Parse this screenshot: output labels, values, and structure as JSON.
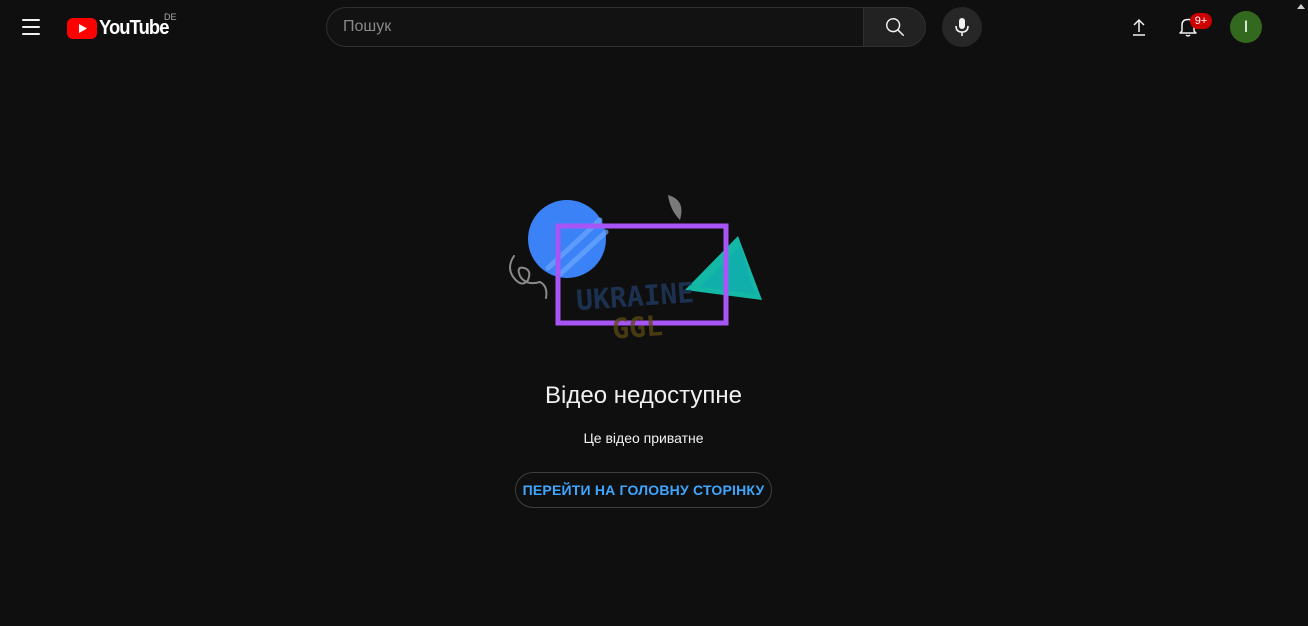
{
  "header": {
    "logo_text": "YouTube",
    "logo_region": "DE",
    "search_placeholder": "Пошук",
    "notification_badge": "9+",
    "avatar_letter": "I"
  },
  "icons": {
    "menu": "hamburger-menu-icon",
    "search": "search-icon",
    "mic": "microphone-icon",
    "upload": "upload-icon",
    "bell": "bell-icon",
    "logo": "youtube-play-icon"
  },
  "main": {
    "title": "Відео недоступне",
    "subtitle": "Це відео приватне",
    "home_button": "ПЕРЕЙТИ НА ГОЛОВНУ СТОРІНКУ"
  },
  "watermark": {
    "line1": "UKRAINE",
    "line2": "GGL"
  },
  "colors": {
    "background": "#0f0f0f",
    "brand_red": "#ff0000",
    "link_blue": "#3ea6ff",
    "avatar_green": "#33691e",
    "badge_red": "#cc0000"
  }
}
